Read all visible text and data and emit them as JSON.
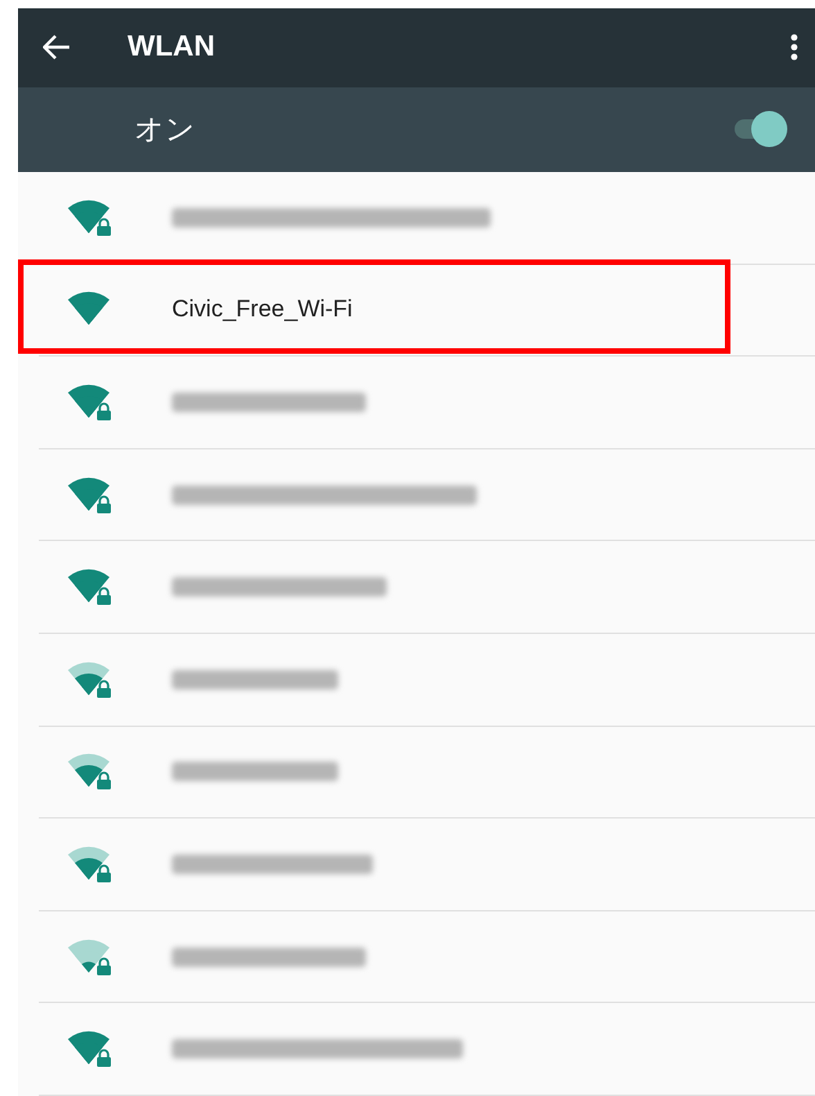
{
  "toolbar": {
    "title": "WLAN"
  },
  "switch_bar": {
    "label": "オン",
    "on": true
  },
  "networks": [
    {
      "kind": "full",
      "secured": true,
      "highlighted": false
    },
    {
      "kind": "full",
      "name": "Civic_Free_Wi-Fi",
      "secured": false,
      "highlighted": true
    },
    {
      "kind": "full",
      "secured": true,
      "highlighted": false
    },
    {
      "kind": "full",
      "secured": true,
      "highlighted": false
    },
    {
      "kind": "full",
      "secured": true,
      "highlighted": false
    },
    {
      "kind": "strong",
      "secured": true,
      "highlighted": false
    },
    {
      "kind": "strong",
      "secured": true,
      "highlighted": false
    },
    {
      "kind": "strong",
      "secured": true,
      "highlighted": false
    },
    {
      "kind": "medium",
      "secured": true,
      "highlighted": false
    },
    {
      "kind": "full",
      "secured": true,
      "highlighted": false
    }
  ]
}
